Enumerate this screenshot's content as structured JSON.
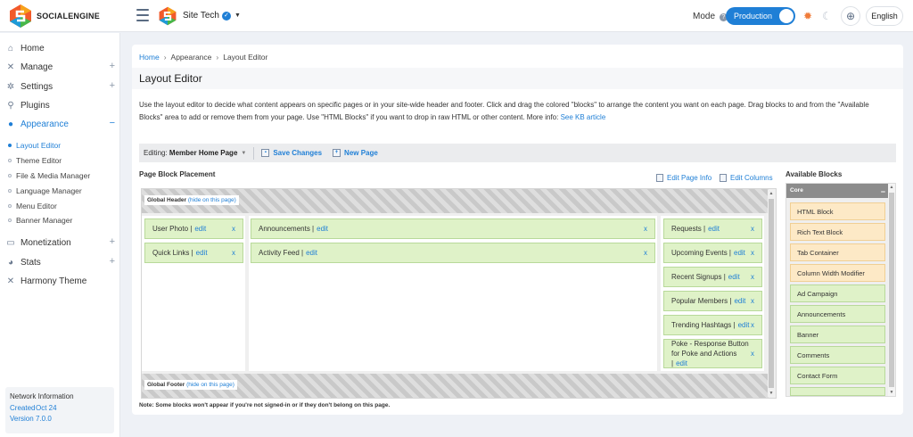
{
  "brand": {
    "name": "SOCIALENGINE",
    "site_name": "Site Tech"
  },
  "header": {
    "mode_label": "Mode",
    "mode_help": "?",
    "mode_value": "Production",
    "language": "English"
  },
  "sidebar": {
    "items": [
      {
        "label": "Home",
        "icon": "home-icon",
        "plus": ""
      },
      {
        "label": "Manage",
        "icon": "wrench-icon",
        "plus": "+"
      },
      {
        "label": "Settings",
        "icon": "gear-icon",
        "plus": "+"
      },
      {
        "label": "Plugins",
        "icon": "plug-icon",
        "plus": ""
      },
      {
        "label": "Appearance",
        "icon": "palette-icon",
        "plus": "−"
      },
      {
        "label": "Monetization",
        "icon": "monetization-icon",
        "plus": "+"
      },
      {
        "label": "Stats",
        "icon": "pie-chart-icon",
        "plus": "+"
      },
      {
        "label": "Harmony Theme",
        "icon": "wrench-icon",
        "plus": ""
      }
    ],
    "sub_items": [
      "Layout Editor",
      "Theme Editor",
      "File & Media Manager",
      "Language Manager",
      "Menu Editor",
      "Banner Manager"
    ],
    "network": {
      "title": "Network Information",
      "created_label": "Created",
      "created_value": "Oct 24",
      "version_label": "Version",
      "version_value": "7.0.0"
    }
  },
  "breadcrumb": [
    "Home",
    "Appearance",
    "Layout Editor"
  ],
  "page_title": "Layout Editor",
  "description": {
    "text": "Use the layout editor to decide what content appears on specific pages or in your site-wide header and footer. Click and drag the colored \"blocks\" to arrange the content you want on each page. Drag blocks to and from the \"Available Blocks\" area to add or remove them from your page. Use \"HTML Blocks\" if you want to drop in raw HTML or other content. More info:",
    "link": "See KB article"
  },
  "toolbar": {
    "editing_label": "Editing:",
    "editing_page": "Member Home Page",
    "save": "Save Changes",
    "new_page": "New Page"
  },
  "placement": {
    "title": "Page Block Placement",
    "edit_page_info": "Edit Page Info",
    "edit_columns": "Edit Columns",
    "header_label": "Global Header",
    "footer_label": "Global Footer",
    "hide_link": "(hide on this page)",
    "edit_word": "edit",
    "remove": "x",
    "left_blocks": [
      "User Photo |",
      "Quick Links |"
    ],
    "middle_blocks": [
      "Announcements |",
      "Activity Feed |"
    ],
    "right_blocks": [
      "Requests |",
      "Upcoming Events |",
      "Recent Signups |",
      "Popular Members |",
      "Trending Hashtags |",
      "Poke - Response Button for Poke and Actions |"
    ]
  },
  "available": {
    "title": "Available Blocks",
    "group": "Core",
    "collapse": "−",
    "blocks": [
      {
        "label": "HTML Block",
        "color": "orange"
      },
      {
        "label": "Rich Text Block",
        "color": "orange"
      },
      {
        "label": "Tab Container",
        "color": "orange"
      },
      {
        "label": "Column Width Modifier",
        "color": "orange"
      },
      {
        "label": "Ad Campaign",
        "color": "green"
      },
      {
        "label": "Announcements",
        "color": "green"
      },
      {
        "label": "Banner",
        "color": "green"
      },
      {
        "label": "Comments",
        "color": "green"
      },
      {
        "label": "Contact Form",
        "color": "green"
      }
    ]
  },
  "note": "Note: Some blocks won't appear if you're not signed-in or if they don't belong on this page."
}
